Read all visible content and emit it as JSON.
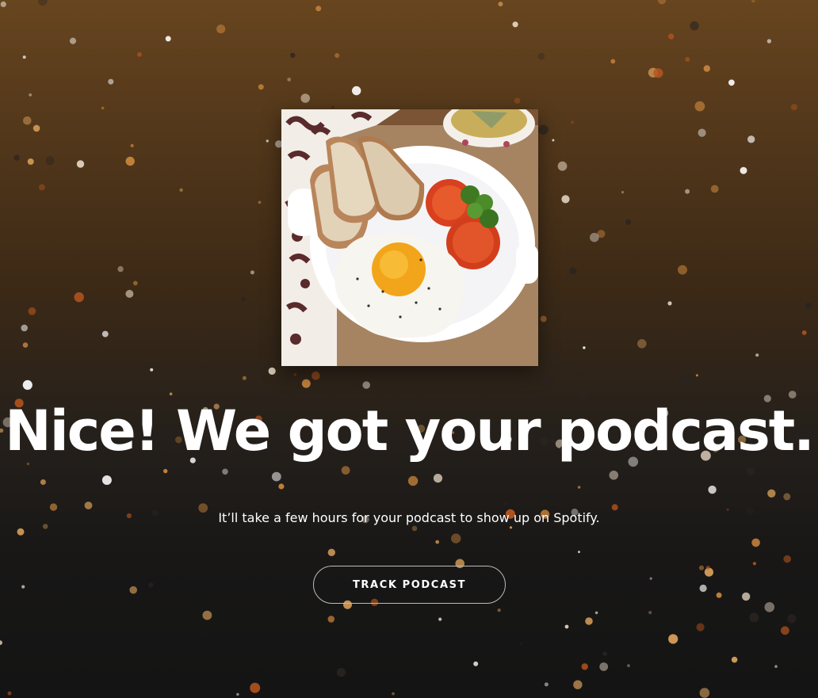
{
  "page": {
    "headline": "Nice! We got your podcast.",
    "subline": "It’ll take a few hours for your podcast to show up on Spotify.",
    "track_button_label": "TRACK PODCAST"
  },
  "cover_art": {
    "depicts": "fried-egg-toast-breakfast-plate"
  },
  "colors": {
    "background_top": "#67451f",
    "background_bottom": "#141414",
    "text": "#ffffff",
    "button_border": "#bdbdbd",
    "confetti": [
      "#ffffff",
      "#e6d6c2",
      "#c9853d",
      "#b8561f",
      "#d9a05b",
      "#2a2420"
    ]
  }
}
